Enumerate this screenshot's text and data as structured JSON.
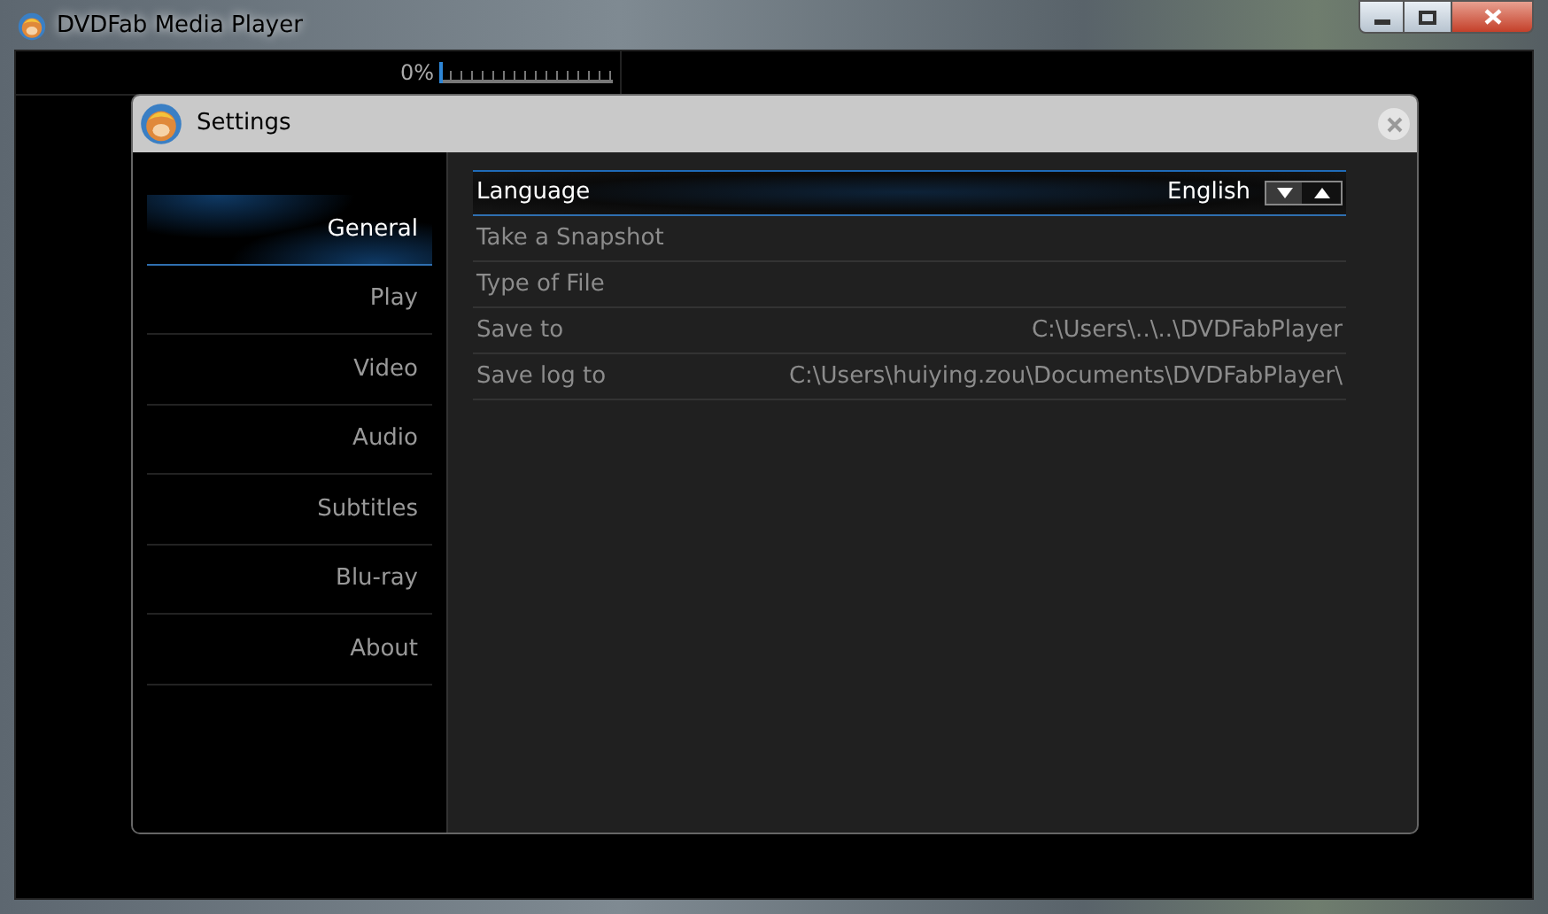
{
  "window": {
    "title": "DVDFab Media Player"
  },
  "progress": {
    "reading": "0%",
    "level": 0
  },
  "dialog": {
    "title": "Settings",
    "sidebar": {
      "items": [
        {
          "label": "General",
          "selected": true
        },
        {
          "label": "Play",
          "selected": false
        },
        {
          "label": "Video",
          "selected": false
        },
        {
          "label": "Audio",
          "selected": false
        },
        {
          "label": "Subtitles",
          "selected": false
        },
        {
          "label": "Blu-ray",
          "selected": false
        },
        {
          "label": "About",
          "selected": false
        }
      ]
    },
    "rows": [
      {
        "kind": "select",
        "label": "Language",
        "value": "English",
        "selected": true
      },
      {
        "kind": "plain",
        "label": "Take a Snapshot",
        "selected": false
      },
      {
        "kind": "plain",
        "label": "Type of File",
        "selected": false
      },
      {
        "kind": "path",
        "label": "Save to",
        "value": "C:\\Users\\..\\..\\DVDFabPlayer",
        "selected": false
      },
      {
        "kind": "path",
        "label": "Save log to",
        "value": "C:\\Users\\huiying.zou\\Documents\\DVDFabPlayer\\",
        "selected": false
      }
    ]
  }
}
